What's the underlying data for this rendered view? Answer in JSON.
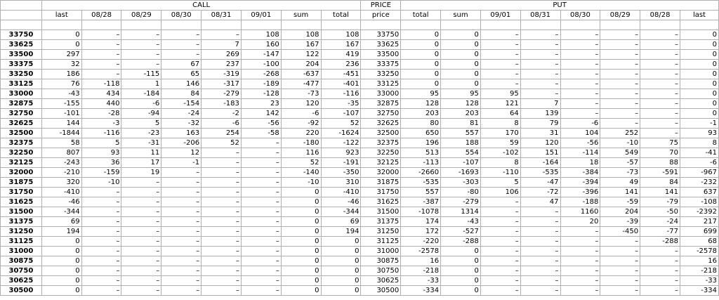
{
  "group_headers": {
    "call": "CALL",
    "price": "PRICE",
    "put": "PUT"
  },
  "call_columns": [
    "last",
    "08/28",
    "08/29",
    "08/30",
    "08/31",
    "09/01",
    "sum",
    "total"
  ],
  "price_column": "price",
  "put_columns": [
    "total",
    "sum",
    "09/01",
    "08/31",
    "08/30",
    "08/29",
    "08/28",
    "last"
  ],
  "rows": [
    {
      "strike": "33750",
      "call": [
        "0",
        "–",
        "–",
        "–",
        "–",
        "108",
        "108",
        "108"
      ],
      "price": "33750",
      "put": [
        "0",
        "0",
        "–",
        "–",
        "–",
        "–",
        "–",
        "0"
      ]
    },
    {
      "strike": "33625",
      "call": [
        "0",
        "–",
        "–",
        "–",
        "7",
        "160",
        "167",
        "167"
      ],
      "price": "33625",
      "put": [
        "0",
        "0",
        "–",
        "–",
        "–",
        "–",
        "–",
        "0"
      ]
    },
    {
      "strike": "33500",
      "call": [
        "297",
        "–",
        "–",
        "–",
        "269",
        "-147",
        "122",
        "419"
      ],
      "price": "33500",
      "put": [
        "0",
        "0",
        "–",
        "–",
        "–",
        "–",
        "–",
        "0"
      ]
    },
    {
      "strike": "33375",
      "call": [
        "32",
        "–",
        "–",
        "67",
        "237",
        "-100",
        "204",
        "236"
      ],
      "price": "33375",
      "put": [
        "0",
        "0",
        "–",
        "–",
        "–",
        "–",
        "–",
        "0"
      ]
    },
    {
      "strike": "33250",
      "call": [
        "186",
        "–",
        "-115",
        "65",
        "-319",
        "-268",
        "-637",
        "-451"
      ],
      "price": "33250",
      "put": [
        "0",
        "0",
        "–",
        "–",
        "–",
        "–",
        "–",
        "0"
      ]
    },
    {
      "strike": "33125",
      "call": [
        "76",
        "-118",
        "1",
        "146",
        "-317",
        "-189",
        "-477",
        "-401"
      ],
      "price": "33125",
      "put": [
        "0",
        "0",
        "–",
        "–",
        "–",
        "–",
        "–",
        "0"
      ]
    },
    {
      "strike": "33000",
      "call": [
        "-43",
        "434",
        "-184",
        "84",
        "-279",
        "-128",
        "-73",
        "-116"
      ],
      "price": "33000",
      "put": [
        "95",
        "95",
        "95",
        "–",
        "–",
        "–",
        "–",
        "0"
      ]
    },
    {
      "strike": "32875",
      "call": [
        "-155",
        "440",
        "-6",
        "-154",
        "-183",
        "23",
        "120",
        "-35"
      ],
      "price": "32875",
      "put": [
        "128",
        "128",
        "121",
        "7",
        "–",
        "–",
        "–",
        "0"
      ]
    },
    {
      "strike": "32750",
      "call": [
        "-101",
        "-28",
        "-94",
        "-24",
        "-2",
        "142",
        "-6",
        "-107"
      ],
      "price": "32750",
      "put": [
        "203",
        "203",
        "64",
        "139",
        "–",
        "–",
        "–",
        "0"
      ]
    },
    {
      "strike": "32625",
      "call": [
        "144",
        "-3",
        "5",
        "-32",
        "-6",
        "-56",
        "-92",
        "52"
      ],
      "price": "32625",
      "put": [
        "80",
        "81",
        "8",
        "79",
        "-6",
        "–",
        "–",
        "-1"
      ]
    },
    {
      "strike": "32500",
      "call": [
        "-1844",
        "-116",
        "-23",
        "163",
        "254",
        "-58",
        "220",
        "-1624"
      ],
      "price": "32500",
      "put": [
        "650",
        "557",
        "170",
        "31",
        "104",
        "252",
        "–",
        "93"
      ]
    },
    {
      "strike": "32375",
      "call": [
        "58",
        "5",
        "-31",
        "-206",
        "52",
        "–",
        "-180",
        "-122"
      ],
      "price": "32375",
      "put": [
        "196",
        "188",
        "59",
        "120",
        "-56",
        "-10",
        "75",
        "8"
      ]
    },
    {
      "strike": "32250",
      "call": [
        "807",
        "93",
        "11",
        "12",
        "–",
        "–",
        "116",
        "923"
      ],
      "price": "32250",
      "put": [
        "513",
        "554",
        "-102",
        "151",
        "-114",
        "549",
        "70",
        "-41"
      ]
    },
    {
      "strike": "32125",
      "call": [
        "-243",
        "36",
        "17",
        "-1",
        "–",
        "–",
        "52",
        "-191"
      ],
      "price": "32125",
      "put": [
        "-113",
        "-107",
        "8",
        "-164",
        "18",
        "-57",
        "88",
        "-6"
      ]
    },
    {
      "strike": "32000",
      "call": [
        "-210",
        "-159",
        "19",
        "–",
        "–",
        "–",
        "-140",
        "-350"
      ],
      "price": "32000",
      "put": [
        "-2660",
        "-1693",
        "-110",
        "-535",
        "-384",
        "-73",
        "-591",
        "-967"
      ]
    },
    {
      "strike": "31875",
      "call": [
        "320",
        "-10",
        "–",
        "–",
        "–",
        "–",
        "-10",
        "310"
      ],
      "price": "31875",
      "put": [
        "-535",
        "-303",
        "5",
        "-47",
        "-394",
        "49",
        "84",
        "-232"
      ]
    },
    {
      "strike": "31750",
      "call": [
        "-410",
        "–",
        "–",
        "–",
        "–",
        "–",
        "0",
        "-410"
      ],
      "price": "31750",
      "put": [
        "557",
        "-80",
        "106",
        "-72",
        "-396",
        "141",
        "141",
        "637"
      ]
    },
    {
      "strike": "31625",
      "call": [
        "-46",
        "–",
        "–",
        "–",
        "–",
        "–",
        "0",
        "-46"
      ],
      "price": "31625",
      "put": [
        "-387",
        "-279",
        "–",
        "47",
        "-188",
        "-59",
        "-79",
        "-108"
      ]
    },
    {
      "strike": "31500",
      "call": [
        "-344",
        "–",
        "–",
        "–",
        "–",
        "–",
        "0",
        "-344"
      ],
      "price": "31500",
      "put": [
        "-1078",
        "1314",
        "–",
        "–",
        "1160",
        "204",
        "-50",
        "-2392"
      ]
    },
    {
      "strike": "31375",
      "call": [
        "69",
        "–",
        "–",
        "–",
        "–",
        "–",
        "0",
        "69"
      ],
      "price": "31375",
      "put": [
        "174",
        "-43",
        "–",
        "–",
        "20",
        "-39",
        "-24",
        "217"
      ]
    },
    {
      "strike": "31250",
      "call": [
        "194",
        "–",
        "–",
        "–",
        "–",
        "–",
        "0",
        "194"
      ],
      "price": "31250",
      "put": [
        "172",
        "-527",
        "–",
        "–",
        "–",
        "-450",
        "-77",
        "699"
      ]
    },
    {
      "strike": "31125",
      "call": [
        "0",
        "–",
        "–",
        "–",
        "–",
        "–",
        "0",
        "0"
      ],
      "price": "31125",
      "put": [
        "-220",
        "-288",
        "–",
        "–",
        "–",
        "–",
        "-288",
        "68"
      ]
    },
    {
      "strike": "31000",
      "call": [
        "0",
        "–",
        "–",
        "–",
        "–",
        "–",
        "0",
        "0"
      ],
      "price": "31000",
      "put": [
        "-2578",
        "0",
        "–",
        "–",
        "–",
        "–",
        "–",
        "-2578"
      ]
    },
    {
      "strike": "30875",
      "call": [
        "0",
        "–",
        "–",
        "–",
        "–",
        "–",
        "0",
        "0"
      ],
      "price": "30875",
      "put": [
        "16",
        "0",
        "–",
        "–",
        "–",
        "–",
        "–",
        "16"
      ]
    },
    {
      "strike": "30750",
      "call": [
        "0",
        "–",
        "–",
        "–",
        "–",
        "–",
        "0",
        "0"
      ],
      "price": "30750",
      "put": [
        "-218",
        "0",
        "–",
        "–",
        "–",
        "–",
        "–",
        "-218"
      ]
    },
    {
      "strike": "30625",
      "call": [
        "0",
        "–",
        "–",
        "–",
        "–",
        "–",
        "0",
        "0"
      ],
      "price": "30625",
      "put": [
        "-33",
        "0",
        "–",
        "–",
        "–",
        "–",
        "–",
        "-33"
      ]
    },
    {
      "strike": "30500",
      "call": [
        "0",
        "–",
        "–",
        "–",
        "–",
        "–",
        "0",
        "0"
      ],
      "price": "30500",
      "put": [
        "-334",
        "0",
        "–",
        "–",
        "–",
        "–",
        "–",
        "-334"
      ]
    }
  ]
}
